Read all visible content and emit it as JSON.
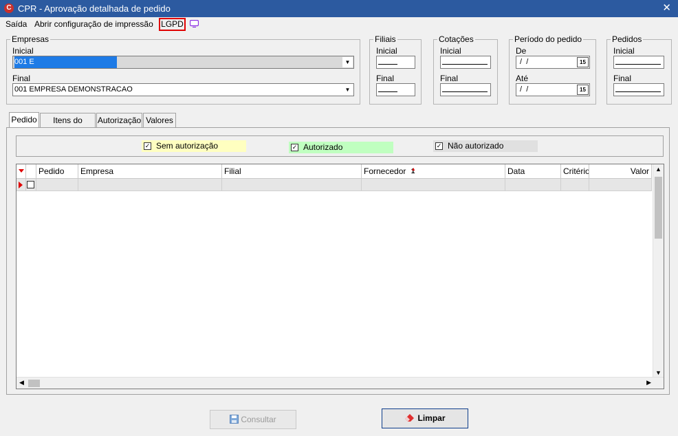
{
  "window": {
    "title": "CPR - Aprovação detalhada de pedido",
    "close_glyph": "✕",
    "icon": "cpr-logo-icon"
  },
  "menu": {
    "items": [
      "Saída",
      "Abrir configuração de impressão",
      "LGPD"
    ],
    "screen_icon": "monitor-icon"
  },
  "empresas": {
    "title": "Empresas",
    "inicial_label": "Inicial",
    "inicial_value": "001 E",
    "final_label": "Final",
    "final_value": "001 EMPRESA DEMONSTRACAO"
  },
  "filiais": {
    "title": "Filiais",
    "inicial_label": "Inicial",
    "final_label": "Final"
  },
  "cotacoes": {
    "title": "Cotações",
    "inicial_label": "Inicial",
    "final_label": "Final"
  },
  "periodo": {
    "title": "Período do pedido",
    "de_label": "De",
    "de_value": " /  /",
    "ate_label": "Até",
    "ate_value": " /  /",
    "calendar_glyph": "15"
  },
  "pedidos": {
    "title": "Pedidos",
    "inicial_label": "Inicial",
    "final_label": "Final"
  },
  "tabs": [
    "Pedido",
    "Itens do pedido",
    "Autorização",
    "Valores"
  ],
  "legend": [
    {
      "label": "Sem autorização",
      "checked": true,
      "color": "#ffffc0"
    },
    {
      "label": "Autorizado",
      "checked": true,
      "color": "#c0ffc0"
    },
    {
      "label": "Não autorizado",
      "checked": true,
      "color": "#e0e0e0"
    }
  ],
  "grid": {
    "columns": [
      "Pedido",
      "Empresa",
      "Filial",
      "Fornecedor",
      "Data",
      "Critério",
      "Valor"
    ],
    "sort_indicator": "1",
    "rows": 1
  },
  "buttons": {
    "consultar": "Consultar",
    "limpar": "Limpar"
  }
}
